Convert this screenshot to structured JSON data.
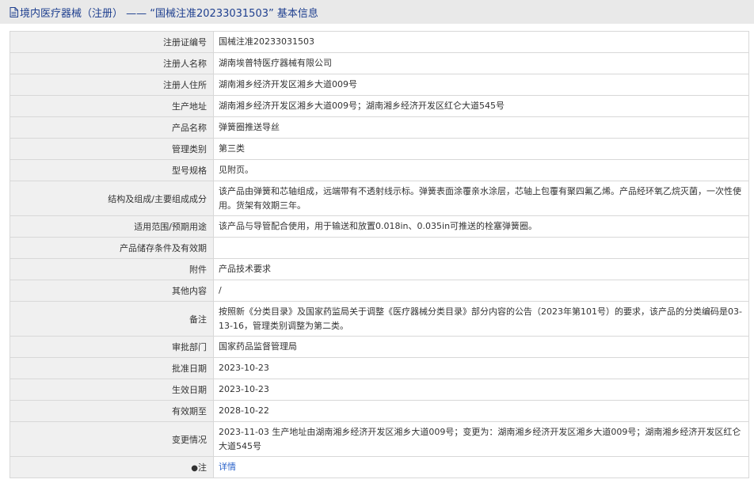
{
  "header": {
    "icon": "document-icon",
    "title": "境内医疗器械（注册） —— “国械注准20233031503” 基本信息"
  },
  "rows": [
    {
      "label": "注册证编号",
      "value": "国械注准20233031503"
    },
    {
      "label": "注册人名称",
      "value": "湖南埃普特医疗器械有限公司"
    },
    {
      "label": "注册人住所",
      "value": "湖南湘乡经济开发区湘乡大道009号"
    },
    {
      "label": "生产地址",
      "value": "湖南湘乡经济开发区湘乡大道009号；湖南湘乡经济开发区红仑大道545号"
    },
    {
      "label": "产品名称",
      "value": "弹簧圈推送导丝"
    },
    {
      "label": "管理类别",
      "value": "第三类"
    },
    {
      "label": "型号规格",
      "value": "见附页。"
    },
    {
      "label": "结构及组成/主要组成成分",
      "value": "该产品由弹簧和芯轴组成，远端带有不透射线示标。弹簧表面涂覆亲水涂层，芯轴上包覆有聚四氟乙烯。产品经环氧乙烷灭菌，一次性使用。货架有效期三年。"
    },
    {
      "label": "适用范围/预期用途",
      "value": "该产品与导管配合使用，用于输送和放置0.018in、0.035in可推送的栓塞弹簧圈。"
    },
    {
      "label": "产品储存条件及有效期",
      "value": ""
    },
    {
      "label": "附件",
      "value": "产品技术要求"
    },
    {
      "label": "其他内容",
      "value": "/"
    },
    {
      "label": "备注",
      "value": "按照新《分类目录》及国家药监局关于调整《医疗器械分类目录》部分内容的公告（2023年第101号）的要求，该产品的分类编码是03-13-16，管理类别调整为第二类。"
    },
    {
      "label": "审批部门",
      "value": "国家药品监督管理局"
    },
    {
      "label": "批准日期",
      "value": "2023-10-23"
    },
    {
      "label": "生效日期",
      "value": "2023-10-23"
    },
    {
      "label": "有效期至",
      "value": "2028-10-22"
    },
    {
      "label": "变更情况",
      "value": "2023-11-03 生产地址由湖南湘乡经济开发区湘乡大道009号；变更为：湖南湘乡经济开发区湘乡大道009号；湖南湘乡经济开发区红仑大道545号"
    }
  ],
  "note": {
    "icon": "map-pin-icon",
    "label": "注",
    "link_text": "详情",
    "link_color": "#2a62c9"
  }
}
